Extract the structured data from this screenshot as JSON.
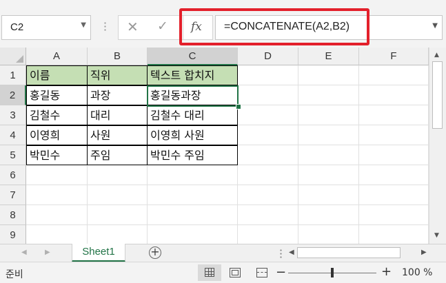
{
  "formula_bar": {
    "name_box": "C2",
    "formula": "=CONCATENATE(A2,B2)",
    "fx_label": "fx"
  },
  "columns": [
    "A",
    "B",
    "C",
    "D",
    "E",
    "F"
  ],
  "rows": [
    "1",
    "2",
    "3",
    "4",
    "5",
    "6",
    "7",
    "8",
    "9"
  ],
  "cells": [
    [
      "이름",
      "직위",
      "텍스트 합치지"
    ],
    [
      "홍길동",
      "과장",
      "홍길동과장"
    ],
    [
      "김철수",
      "대리",
      "김철수 대리"
    ],
    [
      "이영희",
      "사원",
      "이영희 사원"
    ],
    [
      "박민수",
      "주임",
      "박민수 주임"
    ]
  ],
  "active_cell": "C2",
  "header_fill": "#c5dfb4",
  "accent_color": "#217346",
  "highlight_color": "#e3202b",
  "sheet_tabs": [
    "Sheet1"
  ],
  "status": {
    "mode": "준비",
    "zoom": "100 %"
  }
}
